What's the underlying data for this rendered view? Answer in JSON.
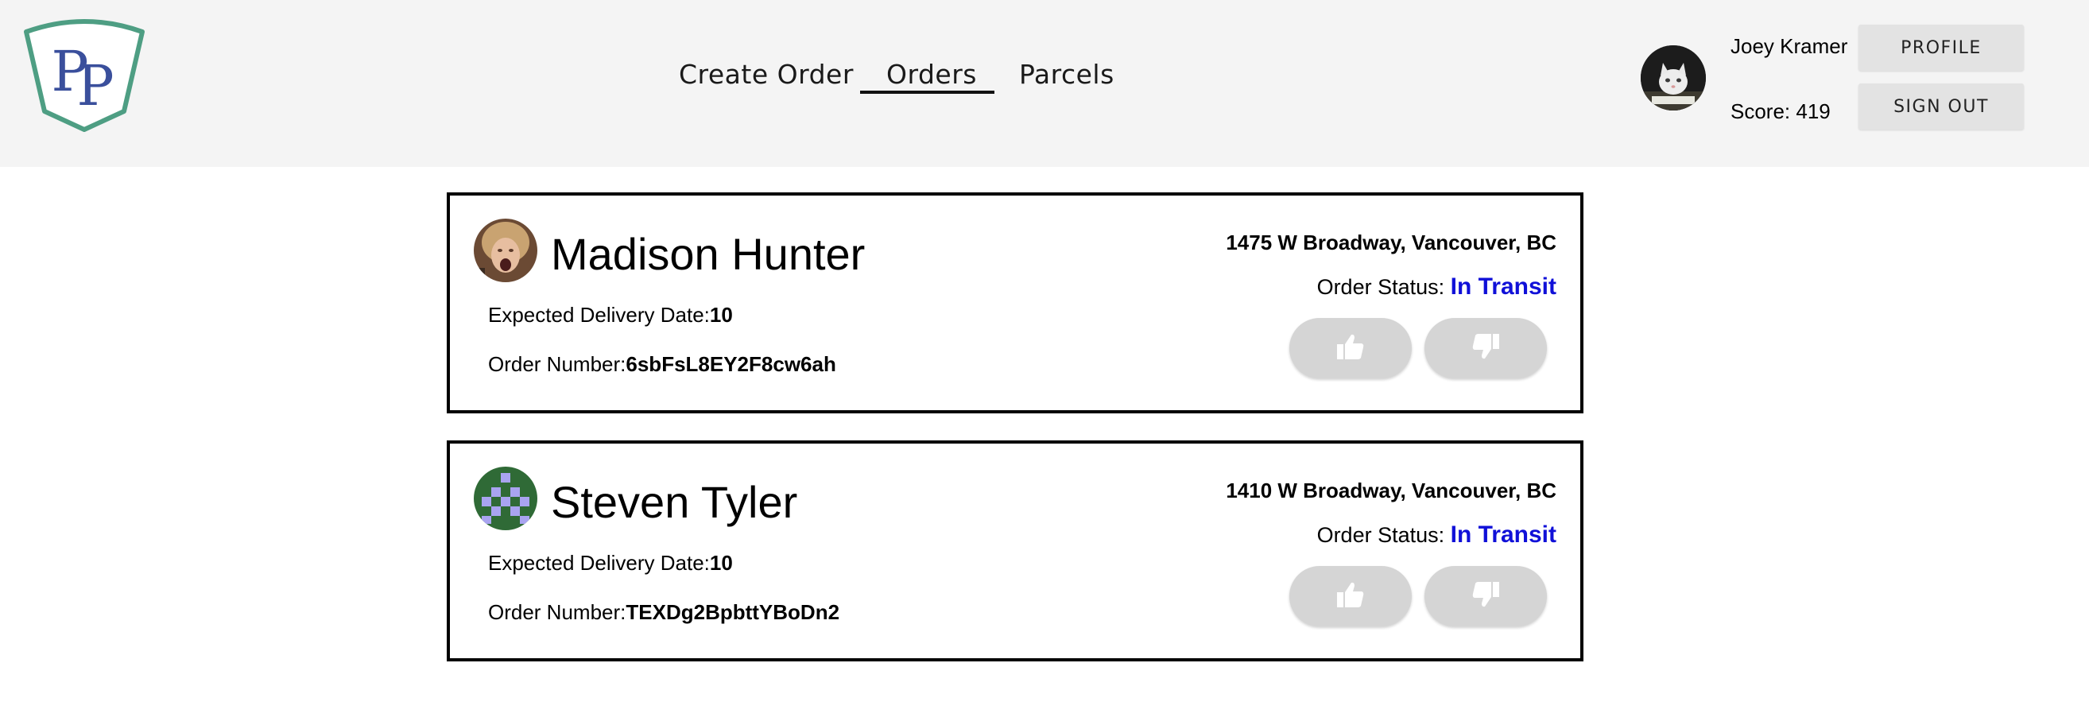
{
  "header": {
    "logo_text": "PP",
    "nav": {
      "create_order": "Create Order",
      "orders": "Orders",
      "parcels": "Parcels"
    },
    "user": {
      "name": "Joey Kramer",
      "score": "Score: 419"
    },
    "profile_label": "PROFILE",
    "sign_out_label": "SIGN OUT"
  },
  "orders": [
    {
      "name": "Madison Hunter",
      "address": "1475 W Broadway, Vancouver, BC",
      "status_label": "Order Status: ",
      "status_value": "In Transit",
      "delivery_label": "Expected Delivery Date:",
      "delivery_value": "10",
      "order_number_label": "Order Number:",
      "order_number_value": "6sbFsL8EY2F8cw6ah"
    },
    {
      "name": "Steven Tyler",
      "address": "1410 W Broadway, Vancouver, BC",
      "status_label": "Order Status: ",
      "status_value": "In Transit",
      "delivery_label": "Expected Delivery Date:",
      "delivery_value": "10",
      "order_number_label": "Order Number:",
      "order_number_value": "TEXDg2BpbttYBoDn2"
    }
  ],
  "icons": {
    "like": "thumbs-up-icon",
    "dislike": "thumbs-down-icon"
  },
  "colors": {
    "header_bg": "#f4f4f4",
    "logo_shield": "#4e9e83",
    "logo_letters": "#3a4f9c",
    "status_in_transit": "#1010d8",
    "vote_button": "#d5d5d5",
    "identicon_bg": "#2f6a36",
    "identicon_fg": "#a9a4f0"
  }
}
